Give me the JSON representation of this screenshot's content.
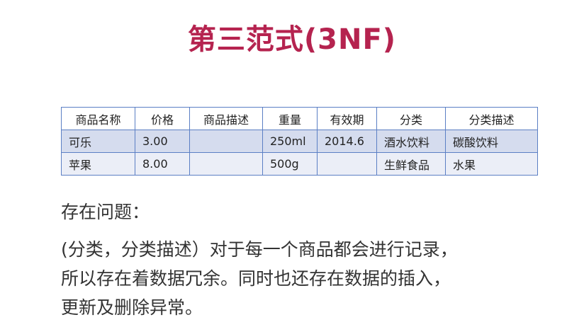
{
  "title": "第三范式(3NF)",
  "table": {
    "headers": [
      "商品名称",
      "价格",
      "商品描述",
      "重量",
      "有效期",
      "分类",
      "分类描述"
    ],
    "rows": [
      [
        "可乐",
        "3.00",
        "",
        "250ml",
        "2014.6",
        "酒水饮料",
        "碳酸饮料"
      ],
      [
        "苹果",
        "8.00",
        "",
        "500g",
        "",
        "生鲜食品",
        "水果"
      ]
    ]
  },
  "issues": {
    "heading": "存在问题：",
    "lines": [
      "(分类，分类描述）对于每一个商品都会进行记录，",
      "所以存在着数据冗余。同时也还存在数据的插入，",
      "更新及删除异常。"
    ]
  }
}
